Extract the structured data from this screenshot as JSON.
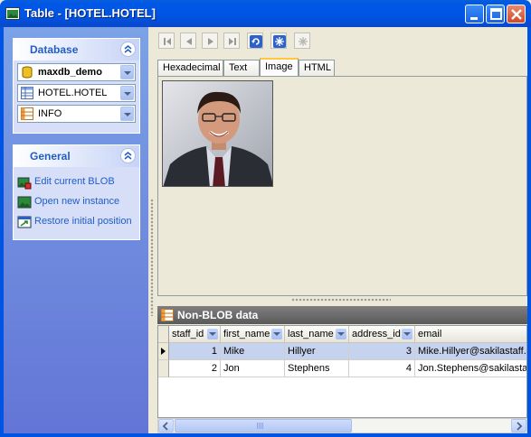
{
  "window": {
    "title": "Table - [HOTEL.HOTEL]"
  },
  "sidebar": {
    "database_panel": {
      "title": "Database",
      "database_combo": "maxdb_demo",
      "table_combo": "HOTEL.HOTEL",
      "field_combo": "INFO"
    },
    "general_panel": {
      "title": "General",
      "links": [
        {
          "label": "Edit current BLOB",
          "icon": "edit-blob-icon"
        },
        {
          "label": "Open new instance",
          "icon": "new-instance-icon"
        },
        {
          "label": "Restore initial position",
          "icon": "restore-position-icon"
        }
      ]
    }
  },
  "toolbar": {
    "buttons": [
      "first-record-icon",
      "prior-record-icon",
      "next-record-icon",
      "last-record-icon",
      "refresh-icon",
      "post-icon",
      "cancel-icon"
    ]
  },
  "tabs": [
    {
      "label": "Hexadecimal",
      "active": false
    },
    {
      "label": "Text",
      "active": false
    },
    {
      "label": "Image",
      "active": true
    },
    {
      "label": "HTML",
      "active": false
    }
  ],
  "non_blob": {
    "title": "Non-BLOB data",
    "columns": [
      "staff_id",
      "first_name",
      "last_name",
      "address_id",
      "email"
    ],
    "rows": [
      [
        "1",
        "Mike",
        "Hillyer",
        "3",
        "Mike.Hillyer@sakilastaff.com"
      ],
      [
        "2",
        "Jon",
        "Stephens",
        "4",
        "Jon.Stephens@sakilastaff.com"
      ]
    ],
    "selected_row": 0
  },
  "colors": {
    "titlebar": "#0054e3",
    "sidebar": "#6f8ddc",
    "link": "#215dc6",
    "selected_row": "#c6d3ef"
  }
}
